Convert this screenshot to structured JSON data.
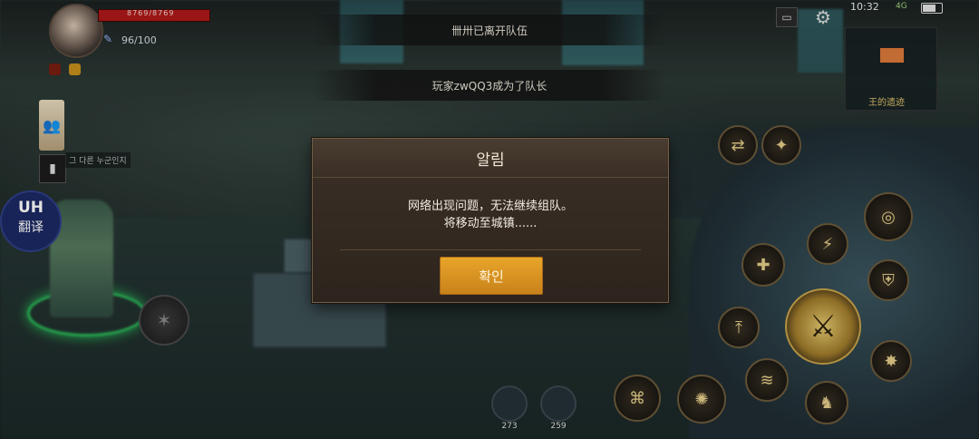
{
  "hud": {
    "hp_text": "8769/8769",
    "mp_text": "96/100",
    "party_icon": "party-icon",
    "gun_icon": "gun-icon",
    "gun_label": "그 다른 누군인지",
    "translate": {
      "logo": "ꓴꓧ",
      "label": "翻译"
    }
  },
  "notices": {
    "first": "卌卅已离开队伍",
    "second": "玩家zwQQ3成为了队长"
  },
  "topbar": {
    "clock": "10:32",
    "status": "4G",
    "map_label": "王的遗迹"
  },
  "dialog": {
    "title": "알림",
    "message_line1": "网络出现问题，无法继续组队。",
    "message_line2": "将移动至城镇......",
    "confirm_label": "확인"
  },
  "consumables": [
    {
      "name": "red-potion",
      "count": "273"
    },
    {
      "name": "blue-potion",
      "count": "259"
    }
  ],
  "colors": {
    "accent": "#d99322",
    "hp": "#b01818",
    "party_ring": "#2bbf5a",
    "dialog_bg": "#3b3027"
  }
}
